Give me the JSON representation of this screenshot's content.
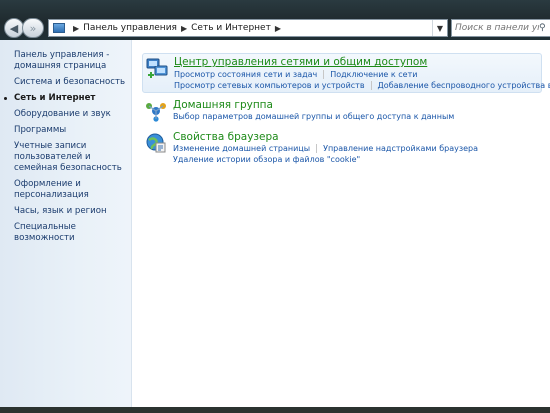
{
  "address_bar": {
    "breadcrumbs": [
      "Панель управления",
      "Сеть и Интернет"
    ],
    "search_placeholder": "Поиск в панели управл..."
  },
  "sidebar": {
    "items": [
      {
        "label": "Панель управления - домашняя страница"
      },
      {
        "label": "Система и безопасность"
      },
      {
        "label": "Сеть и Интернет",
        "current": true
      },
      {
        "label": "Оборудование и звук"
      },
      {
        "label": "Программы"
      },
      {
        "label": "Учетные записи пользователей и семейная безопасность"
      },
      {
        "label": "Оформление и персонализация"
      },
      {
        "label": "Часы, язык и регион"
      },
      {
        "label": "Специальные возможности"
      }
    ]
  },
  "categories": [
    {
      "title": "Центр управления сетями и общим доступом",
      "icon": "network-center-icon",
      "links_row1": [
        "Просмотр состояния сети и задач",
        "Подключение к сети"
      ],
      "links_row2": [
        "Просмотр сетевых компьютеров и устройств",
        "Добавление беспроводного устройства в сеть"
      ]
    },
    {
      "title": "Домашняя группа",
      "icon": "homegroup-icon",
      "links_row1": [
        "Выбор параметров домашней группы и общего доступа к данным"
      ]
    },
    {
      "title": "Свойства браузера",
      "icon": "internet-options-icon",
      "links_row1": [
        "Изменение домашней страницы",
        "Управление надстройками браузера"
      ],
      "links_row2": [
        "Удаление истории обзора и файлов \"cookie\""
      ]
    }
  ],
  "colors": {
    "category_title": "#1d8a18",
    "link": "#1a56a8",
    "sidebar_link": "#1a3b6d"
  }
}
